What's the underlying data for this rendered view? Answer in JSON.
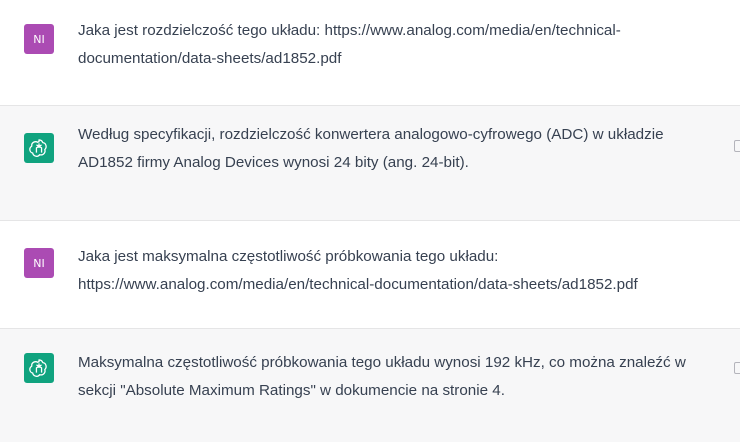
{
  "conversation": {
    "messages": [
      {
        "role": "user",
        "avatar_text": "NI",
        "text": "Jaka jest rozdzielczość tego układu: https://www.analog.com/media/en/technical-documentation/data-sheets/ad1852.pdf"
      },
      {
        "role": "assistant",
        "avatar_icon": "openai-logo-icon",
        "text": "Według specyfikacji, rozdzielczość konwertera analogowo-cyfrowego (ADC) w układzie AD1852 firmy Analog Devices wynosi 24 bity (ang. 24-bit)."
      },
      {
        "role": "user",
        "avatar_text": "NI",
        "text": "Jaka jest maksymalna częstotliwość próbkowania tego układu: https://www.analog.com/media/en/technical-documentation/data-sheets/ad1852.pdf"
      },
      {
        "role": "assistant",
        "avatar_icon": "openai-logo-icon",
        "text": "Maksymalna częstotliwość próbkowania tego układu wynosi 192 kHz, co można znaleźć w sekcji \"Absolute Maximum Ratings\" w dokumencie na stronie 4."
      }
    ]
  },
  "colors": {
    "user_avatar": "#ab4bb3",
    "assistant_avatar": "#10a37f",
    "assistant_bg": "#f7f7f8",
    "text": "#374151"
  }
}
